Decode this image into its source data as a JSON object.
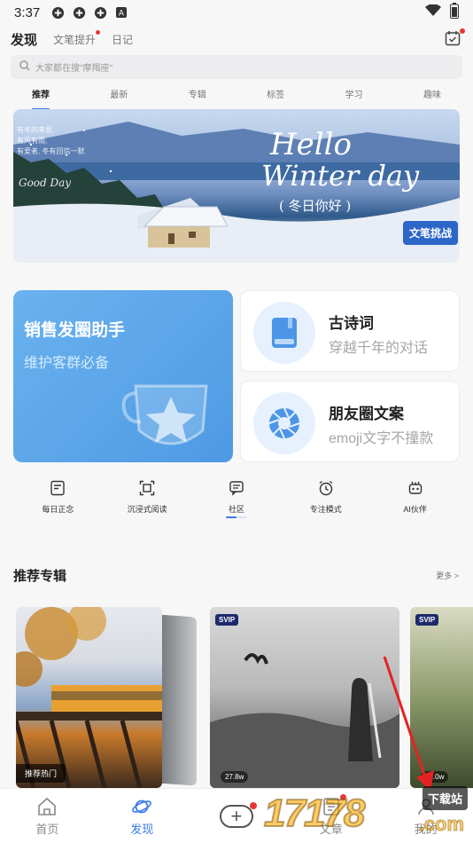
{
  "status": {
    "time": "3:37"
  },
  "topnav": {
    "tabs": [
      {
        "label": "发现",
        "active": true
      },
      {
        "label": "文笔提升",
        "badge": true
      },
      {
        "label": "日记"
      }
    ]
  },
  "search": {
    "placeholder": "大家都在搜\"摩羯座\""
  },
  "categories": [
    "推荐",
    "最新",
    "专辑",
    "标签",
    "学习",
    "趣味"
  ],
  "banner": {
    "tagline_lines": [
      "有冬的来意,",
      "有风有雨,",
      "有爱者, 冬有回信一默"
    ],
    "signature": "Good Day",
    "hello": "Hello",
    "winter_day": "Winter day",
    "zh_title": "( 冬日你好 )",
    "challenge_button": "文笔挑战"
  },
  "features": {
    "big": {
      "title": "销售发圈助手",
      "subtitle": "维护客群必备"
    },
    "cards": [
      {
        "title": "古诗词",
        "subtitle": "穿越千年的对话",
        "icon": "book-icon"
      },
      {
        "title": "朋友圈文案",
        "subtitle": "emoji文字不撞款",
        "icon": "camera-shutter-icon"
      }
    ]
  },
  "quick_actions": [
    {
      "label": "每日正念",
      "icon": "note-icon"
    },
    {
      "label": "沉浸式阅读",
      "icon": "frame-icon"
    },
    {
      "label": "社区",
      "icon": "chat-icon"
    },
    {
      "label": "专注模式",
      "icon": "alarm-icon"
    },
    {
      "label": "AI伙伴",
      "icon": "robot-icon"
    }
  ],
  "section": {
    "title": "推荐专辑",
    "more": "更多 >"
  },
  "albums": [
    {
      "tag": "推荐热门"
    },
    {
      "badge": "SVIP",
      "count": "27.8w"
    },
    {
      "badge": "SVIP",
      "count": "72.0w"
    }
  ],
  "bottomnav": [
    {
      "label": "首页",
      "icon": "home-icon"
    },
    {
      "label": "发现",
      "icon": "planet-icon",
      "active": true
    },
    {
      "label": "",
      "icon": "plus-icon"
    },
    {
      "label": "文章",
      "icon": "article-icon"
    },
    {
      "label": "我的",
      "icon": "profile-icon"
    }
  ],
  "watermark": {
    "digits": "17178",
    "tag": "下载站",
    "com": ".com"
  },
  "colors": {
    "accent": "#3b7bea",
    "badge": "#e53935",
    "banner_button": "#2c66c9"
  }
}
